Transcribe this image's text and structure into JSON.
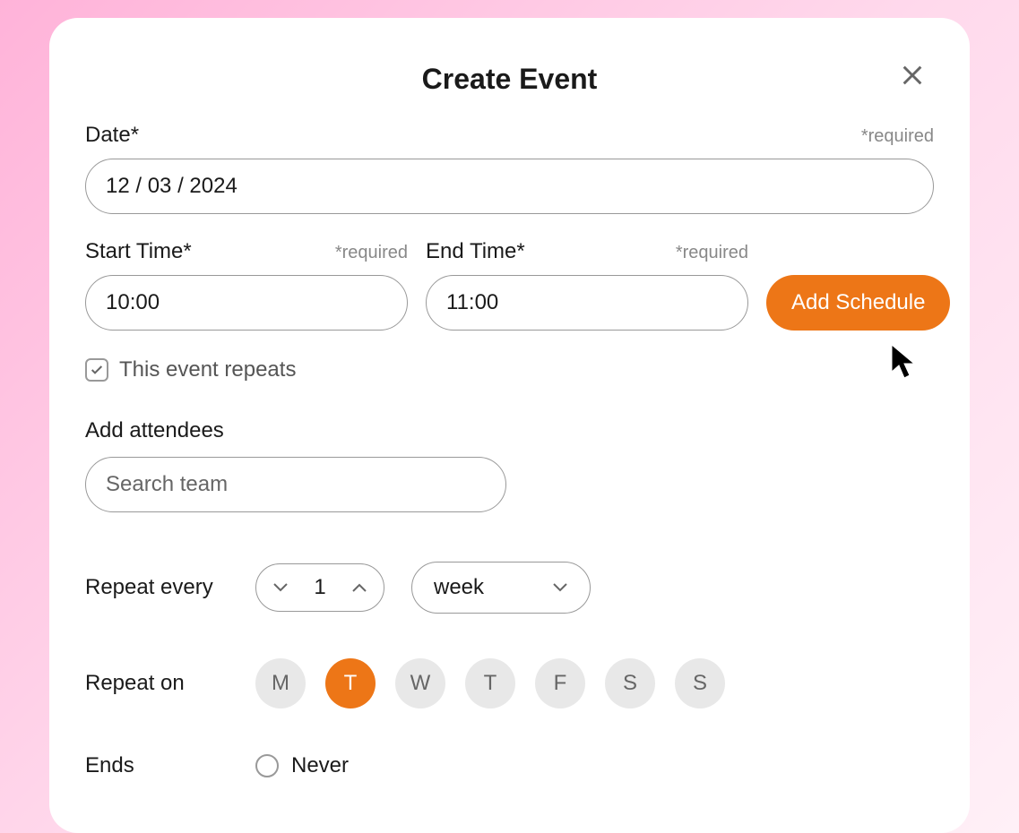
{
  "modal": {
    "title": "Create Event",
    "close_icon": "close"
  },
  "date": {
    "label": "Date*",
    "required_text": "*required",
    "value": "12 / 03 / 2024"
  },
  "start_time": {
    "label": "Start Time*",
    "required_text": "*required",
    "value": "10:00"
  },
  "end_time": {
    "label": "End Time*",
    "required_text": "*required",
    "value": "11:00"
  },
  "add_schedule_label": "Add Schedule",
  "repeats": {
    "checked": true,
    "label": "This event repeats"
  },
  "attendees": {
    "label": "Add attendees",
    "placeholder": "Search team"
  },
  "repeat_every": {
    "label": "Repeat every",
    "value": "1",
    "unit": "week"
  },
  "repeat_on": {
    "label": "Repeat on",
    "days": [
      {
        "letter": "M",
        "selected": false
      },
      {
        "letter": "T",
        "selected": true
      },
      {
        "letter": "W",
        "selected": false
      },
      {
        "letter": "T",
        "selected": false
      },
      {
        "letter": "F",
        "selected": false
      },
      {
        "letter": "S",
        "selected": false
      },
      {
        "letter": "S",
        "selected": false
      }
    ]
  },
  "ends": {
    "label": "Ends",
    "option_never": "Never"
  }
}
